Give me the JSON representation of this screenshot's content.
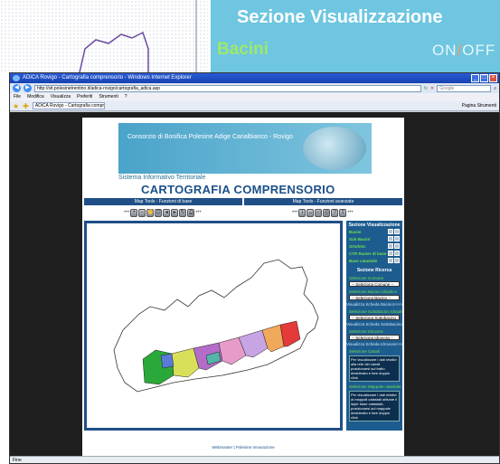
{
  "slide": {
    "title": "Sezione Visualizzazione",
    "layer_label": "Bacini",
    "toggle_on": "ON",
    "toggle_off": "OFF"
  },
  "browser": {
    "window_title": "ADiCA Rovigo - Cartografia comprensorio - Windows Internet Explorer",
    "url": "http://sit.polesinetrentino.it/adica-rovigo/cartografia_adica.asp",
    "search_placeholder": "Google",
    "menu": [
      "File",
      "Modifica",
      "Visualizza",
      "Preferiti",
      "Strumenti",
      "?"
    ],
    "tab_label": "ADiCA Rovigo - Cartografia comprensorio",
    "toolbar_right": "Pagina  Strumenti"
  },
  "site": {
    "consorzio": "Consorzio di Bonifica Polesine Adige Canalbianco - Rovigo",
    "sistema": "Sistema Informativo Territoriale",
    "title": "CARTOGRAFIA COMPRENSORIO",
    "map_tools_base": "Map Tools - Funzioni di base",
    "map_tools_adv": "Map Tools - Funzioni avanzate",
    "footer": "Webmaster | Polesine Innovazione"
  },
  "panel": {
    "vis_title": "Sezione Visualizzazione",
    "layers": [
      "Bacini",
      "Sub Bacini",
      "Ortofoto",
      "CTR Raster di base",
      "Base catastale"
    ],
    "search_title": "Sezione Ricerca",
    "sel_comune": "Selezione Comune",
    "sel_comune_val": "-- Seleziona Comune --",
    "sel_bacino": "Selezione Bacino Idraulico",
    "sel_bacino_val": "-- Seleziona Bacino --",
    "vis_bacino": "Visualizza Scheda Bacino>>>>",
    "sel_sub": "Selezione Sottobacino Idraulico",
    "sel_sub_val": "-- Seleziona Sottobacino --",
    "vis_sub": "Visualizza Scheda Sottobacino>>>>",
    "sel_idrovora": "Selezione Idrovora",
    "sel_idrovora_val": "-- Seleziona Idrovora --",
    "vis_idrovora": "Visualizza Scheda Idrovora>>>>",
    "sel_canali": "Selezione Canali",
    "note_canali": "Per visualizzare i dati relativi alla rete dei canali posizionarsi sul tratto desiderato e fare doppio click",
    "sel_catasto": "Selezione Mappale catastale",
    "note_catasto": "Per visualizzare i dati relativi ai mappali catastali attivare il layer base catastale, posizionarsi sul mappale desiderato e fare doppio click"
  },
  "status": "Fine",
  "colors": {
    "banner": "#6ec6e0",
    "site_blue": "#1f4f86",
    "layer_green": "#6fe24a"
  }
}
